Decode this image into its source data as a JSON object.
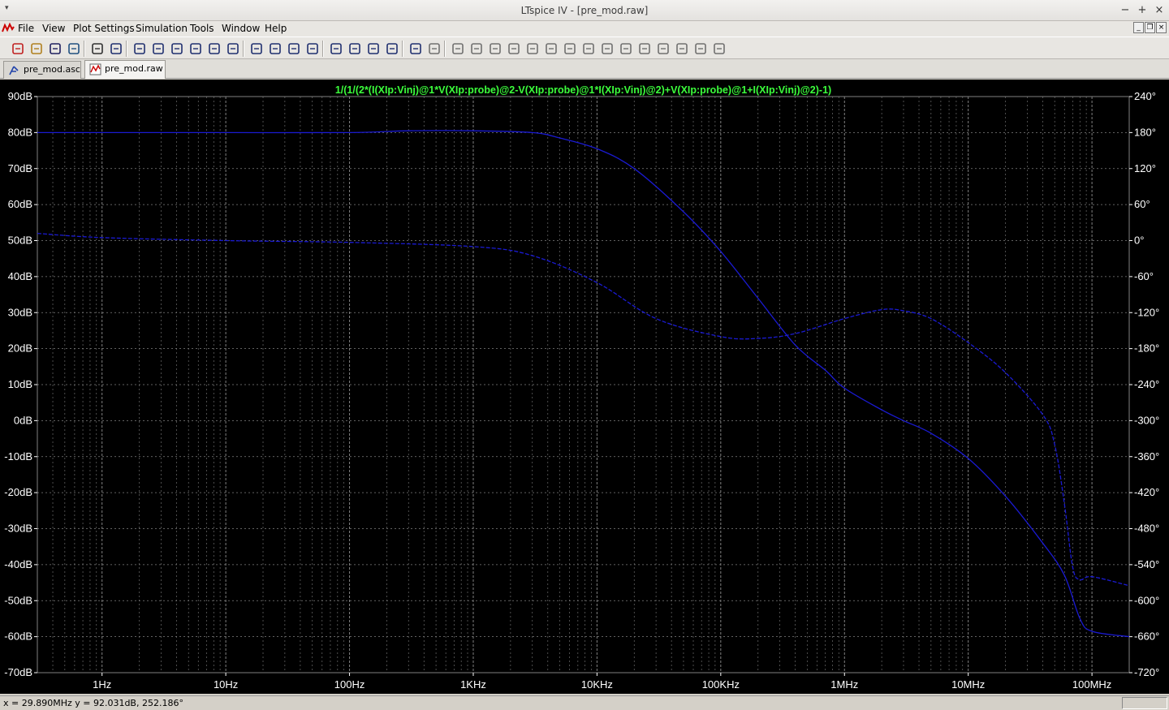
{
  "window": {
    "title": "LTspice IV - [pre_mod.raw]",
    "system_menu_glyph": "▾",
    "minimize_glyph": "−",
    "maximize_glyph": "+",
    "close_glyph": "×"
  },
  "menubar": {
    "items": [
      "File",
      "View",
      "Plot Settings",
      "Simulation",
      "Tools",
      "Window",
      "Help"
    ],
    "mdi_buttons": [
      "_",
      "❐",
      "×"
    ]
  },
  "toolbar": {
    "icons": [
      "new-schematic-icon",
      "open-icon",
      "save-icon",
      "control-panel-icon",
      "run-icon",
      "pan-icon",
      "zoom-in-icon",
      "zoom-back-icon",
      "zoom-out-icon",
      "zoom-fit-icon",
      "autorange-icon",
      "grid-icon",
      "tile-vertical-icon",
      "tile-horizontal-icon",
      "cascade-icon",
      "cut-icon",
      "copy-icon",
      "paste-icon",
      "find-icon",
      "print-setup-icon",
      "print-icon",
      "wire-icon",
      "ground-icon",
      "label-icon",
      "resistor-icon",
      "capacitor-icon",
      "inductor-icon",
      "diode-icon",
      "component-icon",
      "move-icon",
      "drag-icon",
      "undo-icon",
      "redo-icon",
      "rotate-icon",
      "mirror-icon",
      "text-icon",
      "spice-directive-icon"
    ]
  },
  "tabs": [
    {
      "label": "pre_mod.asc",
      "icon": "schematic-icon",
      "active": false
    },
    {
      "label": "pre_mod.raw",
      "icon": "waveform-icon",
      "active": true
    }
  ],
  "statusbar": {
    "readout": "x = 29.890MHz    y = 92.031dB, 252.186°"
  },
  "chart_data": {
    "type": "line",
    "title": "1/(1/(2*(I(XIp:Vinj)@1*V(XIp:probe)@2-V(XIp:probe)@1*I(XIp:Vinj)@2)+V(XIp:probe)@1+I(XIp:Vinj)@2)-1)",
    "xscale": "log",
    "xlim": [
      0.3,
      200000000
    ],
    "xticks": [
      {
        "value": 1,
        "label": "1Hz"
      },
      {
        "value": 10,
        "label": "10Hz"
      },
      {
        "value": 100,
        "label": "100Hz"
      },
      {
        "value": 1000,
        "label": "1KHz"
      },
      {
        "value": 10000,
        "label": "10KHz"
      },
      {
        "value": 100000,
        "label": "100KHz"
      },
      {
        "value": 1000000,
        "label": "1MHz"
      },
      {
        "value": 10000000,
        "label": "10MHz"
      },
      {
        "value": 100000000,
        "label": "100MHz"
      }
    ],
    "ylim_left": [
      -70,
      90
    ],
    "yticks_left": [
      "90dB",
      "80dB",
      "70dB",
      "60dB",
      "50dB",
      "40dB",
      "30dB",
      "20dB",
      "10dB",
      "0dB",
      "-10dB",
      "-20dB",
      "-30dB",
      "-40dB",
      "-50dB",
      "-60dB",
      "-70dB"
    ],
    "ylim_right": [
      -720,
      240
    ],
    "yticks_right": [
      "240°",
      "180°",
      "120°",
      "60°",
      "0°",
      "-60°",
      "-120°",
      "-180°",
      "-240°",
      "-300°",
      "-360°",
      "-420°",
      "-480°",
      "-540°",
      "-600°",
      "-660°",
      "-720°"
    ],
    "grid": true,
    "background": "#000000",
    "grid_color": "#808080",
    "trace_color": "#1a1ad2",
    "title_color": "#3cff3c",
    "axis_label_color": "#ffffff",
    "series": [
      {
        "quantity": "magnitude",
        "axis": "left",
        "style": "solid",
        "x": [
          0.3,
          1,
          10,
          100,
          300,
          1000,
          3000,
          5000,
          10000,
          20000,
          50000,
          100000,
          200000,
          400000,
          700000,
          1000000,
          2000000,
          3000000,
          5000000,
          10000000,
          20000000,
          40000000,
          60000000,
          80000000,
          100000000,
          200000000
        ],
        "y": [
          80,
          80,
          80,
          80,
          80.5,
          80.5,
          80,
          78.5,
          75.5,
          70,
          58,
          47,
          34,
          21,
          14,
          9,
          3,
          0,
          -3.5,
          -10.5,
          -21,
          -34,
          -43,
          -55,
          -58.5,
          -60
        ]
      },
      {
        "quantity": "phase",
        "axis": "right",
        "style": "dashed",
        "x": [
          0.3,
          1,
          10,
          100,
          1000,
          3000,
          10000,
          30000,
          100000,
          200000,
          400000,
          1000000,
          2000000,
          3000000,
          5000000,
          10000000,
          20000000,
          40000000,
          50000000,
          60000000,
          70000000,
          80000000,
          100000000,
          200000000
        ],
        "y": [
          12,
          5,
          0,
          -3,
          -10,
          -25,
          -70,
          -130,
          -160,
          -163,
          -155,
          -130,
          -115,
          -117,
          -130,
          -170,
          -220,
          -290,
          -340,
          -440,
          -545,
          -565,
          -560,
          -575
        ]
      }
    ]
  }
}
